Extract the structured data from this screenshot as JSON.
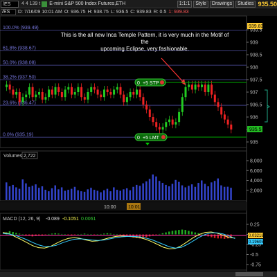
{
  "toolbar": {
    "symbol": "/ES",
    "group": "4 4 139 t",
    "description": "E-mini S&P 500 Index Futures,ETH",
    "zoom": "1:1:1",
    "style_label": "Style",
    "drawings_label": "Drawings",
    "studies_label": "Studies",
    "last_price": "935.50"
  },
  "ohlc_bar": {
    "symbol": "/ES",
    "date_time": "D: 7/16/09 10:01 AM",
    "open": "O: 936.75",
    "high": "H: 938.75",
    "low": "L: 936.5",
    "close": "C: 939.83",
    "range": "R: 0.5",
    "change": "1: 939.83"
  },
  "annotation": {
    "line1": "This is the all new Inca Temple Pattern, it is very much in the Motif of the",
    "line2": "upcoming Eclipse, very fashionable."
  },
  "price_axis": {
    "labels": [
      "939.5",
      "939",
      "938.5",
      "938",
      "937.5",
      "937",
      "936.5",
      "936",
      "935.5",
      "935"
    ],
    "highlight_top": "939.83",
    "current_price": "935.5"
  },
  "fib_levels": [
    {
      "label": "100.0% (939.49)"
    },
    {
      "label": "61.8% (938.67)"
    },
    {
      "label": "50.0% (938.08)"
    },
    {
      "label": "38.2% (937.50)"
    },
    {
      "label": "23.6% (936.47)"
    },
    {
      "label": "0.0% (935.19)"
    }
  ],
  "orders": {
    "stop_label": "+5 STP",
    "limit_label": "+5 LMT",
    "order_qty": "0"
  },
  "volume_panel": {
    "title": "Volumes",
    "value": "2,722",
    "axis_labels": [
      "8,000",
      "6,000",
      "4,000",
      "2,000"
    ]
  },
  "time_axis": {
    "labels": [
      "10:00"
    ],
    "current_time": "10:01"
  },
  "macd_panel": {
    "title": "MACD (12, 26, 9)",
    "v1": "-0.089",
    "v2": "-0.1051",
    "v3": "0.0061",
    "axis_labels": [
      "0.25",
      "0",
      "-0.25",
      "-0.5",
      "-0.75"
    ],
    "value_tag1": "0.03218",
    "value_tag2": "0.19605"
  },
  "colors": {
    "up_candle": "#22cc22",
    "down_candle": "#ee2222",
    "fib_line": "#6666cc",
    "order_green": "#00aa00",
    "price_highlight": "#ffcc33"
  }
}
